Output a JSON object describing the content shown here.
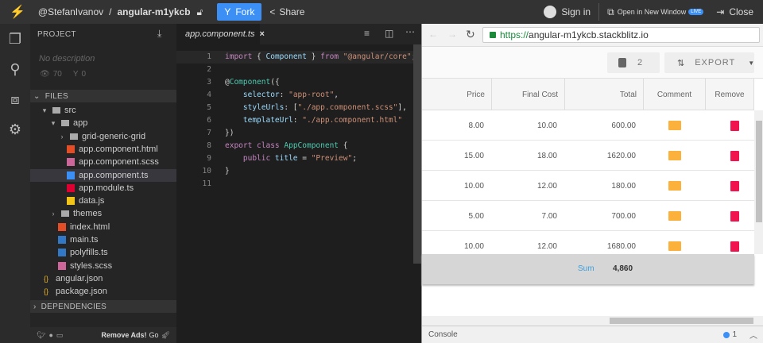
{
  "topbar": {
    "user": "@StefanIvanov",
    "separator": "/",
    "project": "angular-m1ykcb",
    "fork": "Fork",
    "share": "Share",
    "sign_in": "Sign in",
    "open_new": "Open in New Window",
    "live": "LIVE",
    "close": "Close"
  },
  "sidebar": {
    "project_title": "PROJECT",
    "description": "No description",
    "views": "70",
    "forks": "0",
    "files_title": "FILES",
    "dependencies_title": "DEPENDENCIES",
    "tree": [
      {
        "label": "src",
        "indent": 1,
        "type": "folder-open",
        "icon": "▾"
      },
      {
        "label": "app",
        "indent": 2,
        "type": "folder-open",
        "icon": "▾"
      },
      {
        "label": "grid-generic-grid",
        "indent": 3,
        "type": "folder",
        "icon": "›"
      },
      {
        "label": "app.component.html",
        "indent": 4,
        "type": "html"
      },
      {
        "label": "app.component.scss",
        "indent": 4,
        "type": "scss"
      },
      {
        "label": "app.component.ts",
        "indent": 4,
        "type": "ts-angular",
        "selected": true
      },
      {
        "label": "app.module.ts",
        "indent": 4,
        "type": "angular"
      },
      {
        "label": "data.js",
        "indent": 4,
        "type": "js"
      },
      {
        "label": "themes",
        "indent": 2,
        "type": "folder",
        "icon": "›"
      },
      {
        "label": "index.html",
        "indent": 3,
        "type": "html"
      },
      {
        "label": "main.ts",
        "indent": 3,
        "type": "ts"
      },
      {
        "label": "polyfills.ts",
        "indent": 3,
        "type": "ts"
      },
      {
        "label": "styles.scss",
        "indent": 3,
        "type": "scss"
      },
      {
        "label": "angular.json",
        "indent": 1,
        "type": "json"
      },
      {
        "label": "package.json",
        "indent": 1,
        "type": "json"
      }
    ],
    "footer": {
      "remove_ads": "Remove Ads!",
      "go": "Go"
    }
  },
  "editor": {
    "tab": "app.component.ts",
    "lines": [
      [
        [
          "kw",
          "import"
        ],
        [
          "tx",
          " { "
        ],
        [
          "id",
          "Component"
        ],
        [
          "tx",
          " } "
        ],
        [
          "kw",
          "from"
        ],
        [
          "st",
          " \"@angular/core\""
        ],
        [
          "tx",
          ";"
        ]
      ],
      [],
      [
        [
          "tx",
          "@"
        ],
        [
          "de",
          "Component"
        ],
        [
          "tx",
          "({"
        ]
      ],
      [
        [
          "id",
          "    selector"
        ],
        [
          "tx",
          ": "
        ],
        [
          "st",
          "\"app-root\""
        ],
        [
          "tx",
          ","
        ]
      ],
      [
        [
          "id",
          "    styleUrls"
        ],
        [
          "tx",
          ": ["
        ],
        [
          "st",
          "\"./app.component.scss\""
        ],
        [
          "tx",
          "],"
        ]
      ],
      [
        [
          "id",
          "    templateUrl"
        ],
        [
          "tx",
          ": "
        ],
        [
          "st",
          "\"./app.component.html\""
        ]
      ],
      [
        [
          "tx",
          "})"
        ]
      ],
      [
        [
          "kw",
          "export"
        ],
        [
          "kw",
          " class"
        ],
        [
          "de",
          " AppComponent"
        ],
        [
          "tx",
          " {"
        ]
      ],
      [
        [
          "kw",
          "    public"
        ],
        [
          "id",
          " title"
        ],
        [
          "tx",
          " = "
        ],
        [
          "st",
          "\"Preview\""
        ],
        [
          "tx",
          ";"
        ]
      ],
      [
        [
          "tx",
          "}"
        ]
      ],
      []
    ]
  },
  "preview": {
    "url_scheme": "https://",
    "url_host": "angular-m1ykcb.stackblitz.io",
    "lock_count": "2",
    "export": "EXPORT",
    "columns": [
      "Price",
      "Final Cost",
      "Total",
      "Comment",
      "Remove"
    ],
    "rows": [
      [
        "8.00",
        "10.00",
        "600.00"
      ],
      [
        "15.00",
        "18.00",
        "1620.00"
      ],
      [
        "10.00",
        "12.00",
        "180.00"
      ],
      [
        "5.00",
        "7.00",
        "700.00"
      ],
      [
        "10.00",
        "12.00",
        "1680.00"
      ]
    ],
    "sum_label": "Sum",
    "sum_value": "4,860",
    "console": "Console",
    "console_count": "1"
  },
  "colors": {
    "accent": "#3b8ff5",
    "comment": "#fbb13c",
    "remove": "#f0134d"
  }
}
